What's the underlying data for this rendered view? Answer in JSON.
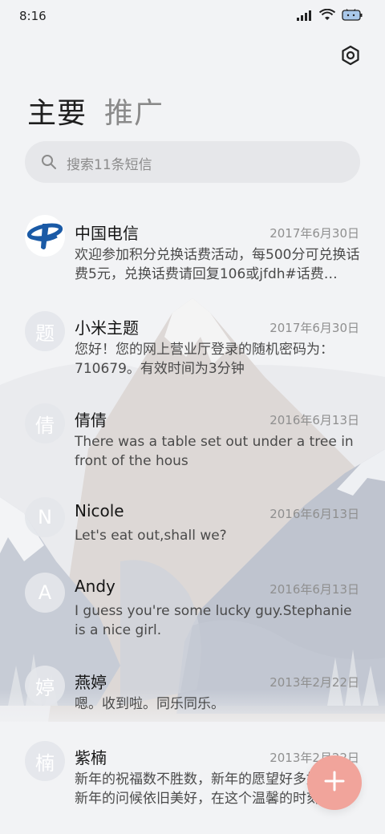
{
  "status_bar": {
    "time": "8:16"
  },
  "icons": {
    "settings": "settings-icon",
    "search": "search-icon",
    "compose": "plus-icon",
    "signal": "signal-icon",
    "wifi": "wifi-icon",
    "battery": "battery-icon"
  },
  "tabs": [
    {
      "label": "主要",
      "active": true
    },
    {
      "label": "推广",
      "active": false
    }
  ],
  "search": {
    "placeholder": "搜索11条短信"
  },
  "threads": [
    {
      "name": "中国电信",
      "date": "2017年6月30日",
      "avatar": "",
      "preview": "欢迎参加积分兑换话费活动，每500分可兑换话费5元，兑换话费请回复106或jfdh#话费…"
    },
    {
      "name": "小米主题",
      "date": "2017年6月30日",
      "avatar": "题",
      "preview": "您好！您的网上营业厅登录的随机密码为：710679。有效时间为3分钟"
    },
    {
      "name": "倩倩",
      "date": "2016年6月13日",
      "avatar": "倩",
      "preview": "There was a table set out under a tree in front of the hous"
    },
    {
      "name": "Nicole",
      "date": "2016年6月13日",
      "avatar": "N",
      "preview": "Let's eat out,shall we?"
    },
    {
      "name": "Andy",
      "date": "2016年6月13日",
      "avatar": "A",
      "preview": "I guess you're some lucky guy.Stephanie is a nice girl."
    },
    {
      "name": "燕婷",
      "date": "2013年2月22日",
      "avatar": "婷",
      "preview": "嗯。收到啦。同乐同乐。"
    },
    {
      "name": "紫楠",
      "date": "2013年2月22日",
      "avatar": "楠",
      "preview": "新年的祝福数不胜数，新年的愿望好多好多，新年的问候依旧美好，在这个温馨的时刻…"
    }
  ],
  "colors": {
    "accent": "#f1a49b",
    "telecom_blue": "#1a5aa6",
    "background": "#f2f3f5"
  }
}
